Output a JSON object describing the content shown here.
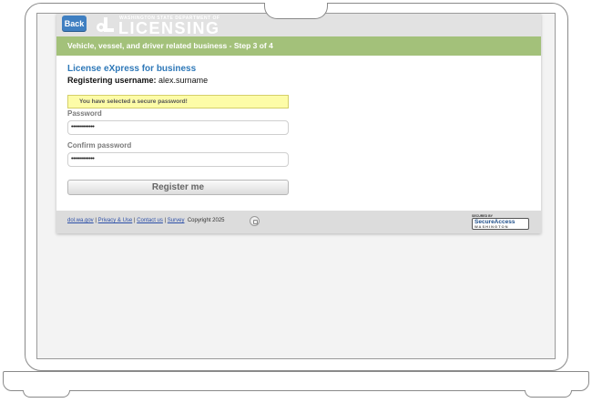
{
  "header": {
    "back_label": "Back",
    "department": "WASHINGTON STATE DEPARTMENT OF",
    "brand": "LICENSING"
  },
  "step_bar": {
    "text": "Vehicle, vessel, and driver related business - Step 3 of 4"
  },
  "form": {
    "title": "License eXpress for business",
    "username_label": "Registering username:",
    "username_value": "alex.surname",
    "notice": "You have selected a secure password!",
    "password_label": "Password",
    "password_value": "•••••••••••••",
    "confirm_label": "Confirm password",
    "confirm_value": "•••••••••••••",
    "register_label": "Register me"
  },
  "footer": {
    "links": [
      "dol.wa.gov",
      "Privacy & Use",
      "Contact us",
      "Survey"
    ],
    "separator": "|",
    "copyright": "Copyright 2025",
    "badge_secured": "SECURED BY",
    "badge_title": "SecureAccess",
    "badge_sub": "WASHINGTON"
  },
  "colors": {
    "accent_green": "#a3c17a",
    "title_blue": "#2e78b8",
    "back_button": "#3f7fc1",
    "notice_yellow": "#fdfca7"
  }
}
